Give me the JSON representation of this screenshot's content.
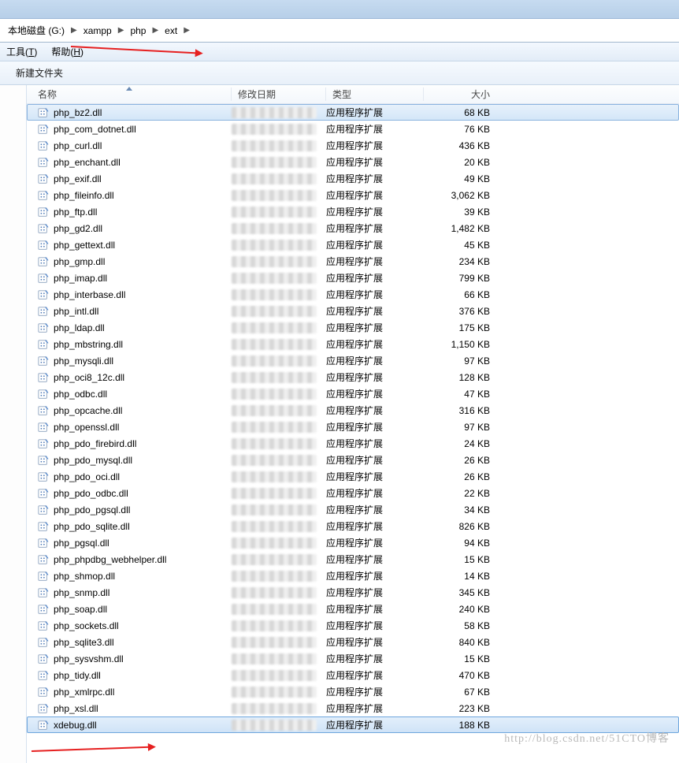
{
  "breadcrumb": {
    "items": [
      "本地磁盘 (G:)",
      "xampp",
      "php",
      "ext"
    ]
  },
  "menubar": {
    "tools": "工具",
    "tools_key": "T",
    "help": "帮助",
    "help_key": "H"
  },
  "toolbar": {
    "new_folder": "新建文件夹"
  },
  "columns": {
    "name": "名称",
    "date": "修改日期",
    "type": "类型",
    "size": "大小"
  },
  "file_type_label": "应用程序扩展",
  "files": [
    {
      "name": "php_bz2.dll",
      "size": "68 KB",
      "selected": "first"
    },
    {
      "name": "php_com_dotnet.dll",
      "size": "76 KB"
    },
    {
      "name": "php_curl.dll",
      "size": "436 KB"
    },
    {
      "name": "php_enchant.dll",
      "size": "20 KB"
    },
    {
      "name": "php_exif.dll",
      "size": "49 KB"
    },
    {
      "name": "php_fileinfo.dll",
      "size": "3,062 KB"
    },
    {
      "name": "php_ftp.dll",
      "size": "39 KB"
    },
    {
      "name": "php_gd2.dll",
      "size": "1,482 KB"
    },
    {
      "name": "php_gettext.dll",
      "size": "45 KB"
    },
    {
      "name": "php_gmp.dll",
      "size": "234 KB"
    },
    {
      "name": "php_imap.dll",
      "size": "799 KB"
    },
    {
      "name": "php_interbase.dll",
      "size": "66 KB"
    },
    {
      "name": "php_intl.dll",
      "size": "376 KB"
    },
    {
      "name": "php_ldap.dll",
      "size": "175 KB"
    },
    {
      "name": "php_mbstring.dll",
      "size": "1,150 KB"
    },
    {
      "name": "php_mysqli.dll",
      "size": "97 KB"
    },
    {
      "name": "php_oci8_12c.dll",
      "size": "128 KB"
    },
    {
      "name": "php_odbc.dll",
      "size": "47 KB"
    },
    {
      "name": "php_opcache.dll",
      "size": "316 KB"
    },
    {
      "name": "php_openssl.dll",
      "size": "97 KB"
    },
    {
      "name": "php_pdo_firebird.dll",
      "size": "24 KB"
    },
    {
      "name": "php_pdo_mysql.dll",
      "size": "26 KB"
    },
    {
      "name": "php_pdo_oci.dll",
      "size": "26 KB"
    },
    {
      "name": "php_pdo_odbc.dll",
      "size": "22 KB"
    },
    {
      "name": "php_pdo_pgsql.dll",
      "size": "34 KB"
    },
    {
      "name": "php_pdo_sqlite.dll",
      "size": "826 KB"
    },
    {
      "name": "php_pgsql.dll",
      "size": "94 KB"
    },
    {
      "name": "php_phpdbg_webhelper.dll",
      "size": "15 KB"
    },
    {
      "name": "php_shmop.dll",
      "size": "14 KB"
    },
    {
      "name": "php_snmp.dll",
      "size": "345 KB"
    },
    {
      "name": "php_soap.dll",
      "size": "240 KB"
    },
    {
      "name": "php_sockets.dll",
      "size": "58 KB"
    },
    {
      "name": "php_sqlite3.dll",
      "size": "840 KB"
    },
    {
      "name": "php_sysvshm.dll",
      "size": "15 KB"
    },
    {
      "name": "php_tidy.dll",
      "size": "470 KB"
    },
    {
      "name": "php_xmlrpc.dll",
      "size": "67 KB"
    },
    {
      "name": "php_xsl.dll",
      "size": "223 KB"
    },
    {
      "name": "xdebug.dll",
      "size": "188 KB",
      "selected": "last"
    }
  ],
  "watermark": "http://blog.csdn.net/51CTO博客"
}
